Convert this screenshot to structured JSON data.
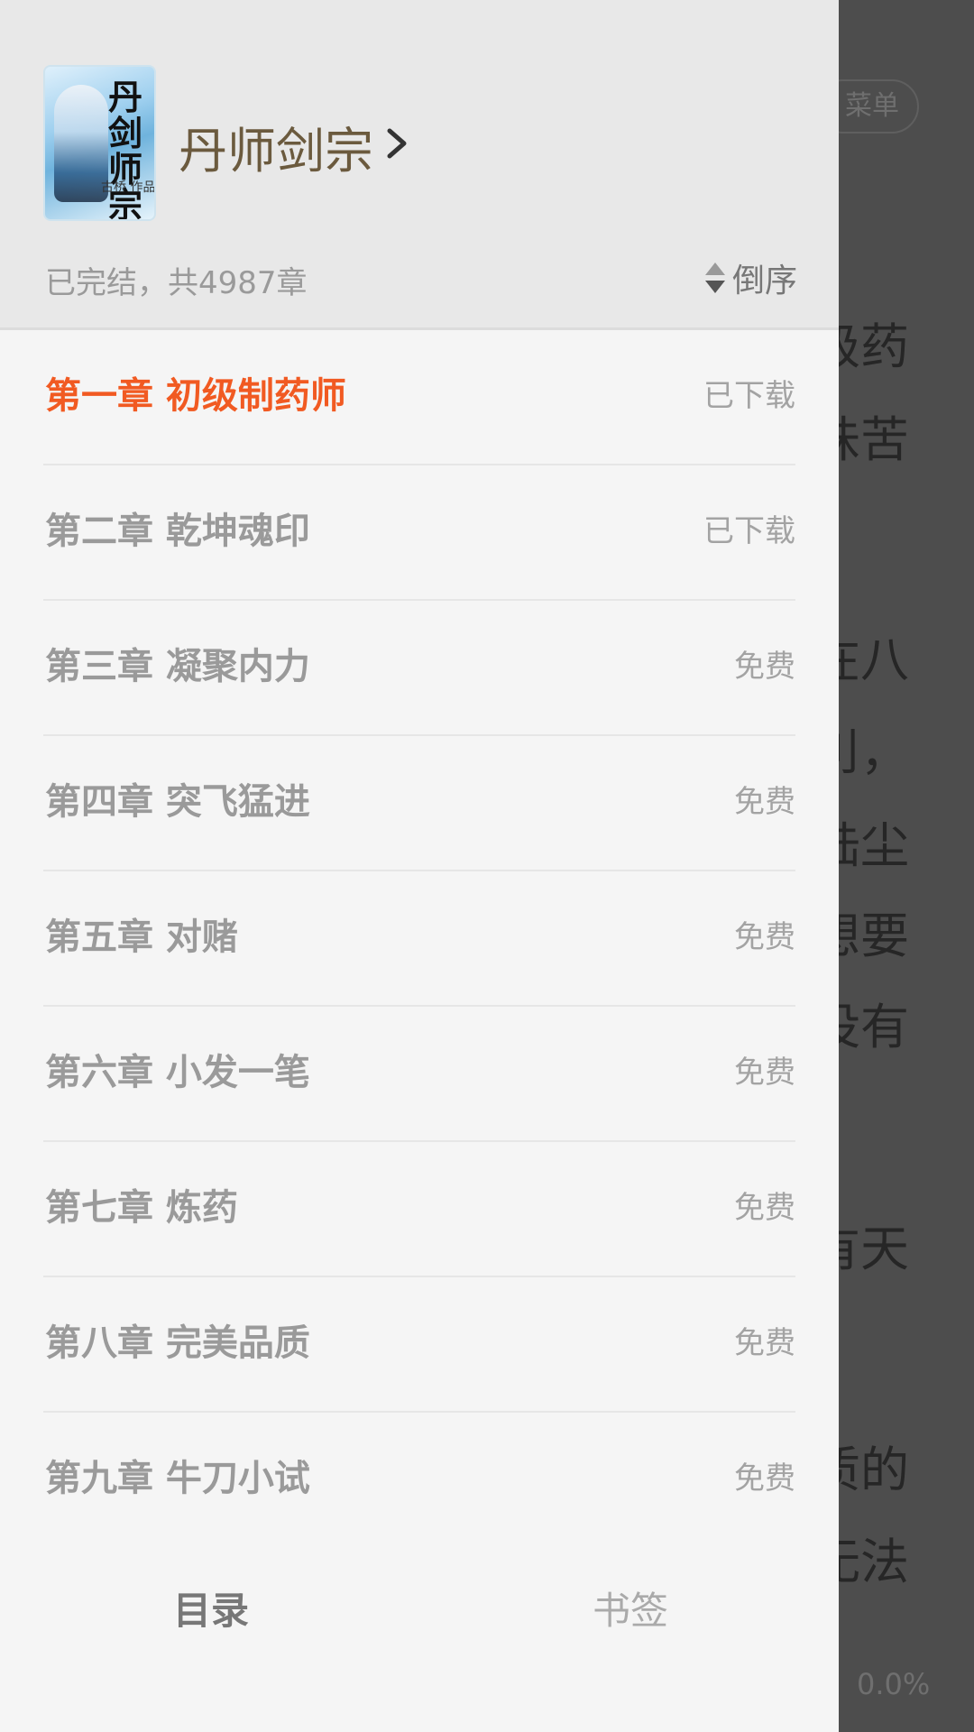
{
  "reader": {
    "menu_label": "菜单",
    "visible_text_fragments": [
      "级药",
      "味苦",
      "在八",
      "刂，",
      "陆尘",
      "想要",
      "没有",
      "有天",
      "质的",
      "无法"
    ],
    "progress": "0.0%"
  },
  "drawer": {
    "book": {
      "title": "丹师剑宗",
      "cover_title_art": "丹剑师宗",
      "cover_author": "古桥 作品",
      "status": "已完结，共4987章",
      "sort_label": "倒序"
    },
    "chapters": [
      {
        "title": "第一章 初级制药师",
        "status": "已下载",
        "active": true
      },
      {
        "title": "第二章 乾坤魂印",
        "status": "已下载",
        "active": false
      },
      {
        "title": "第三章 凝聚内力",
        "status": "免费",
        "active": false
      },
      {
        "title": "第四章 突飞猛进",
        "status": "免费",
        "active": false
      },
      {
        "title": "第五章 对赌",
        "status": "免费",
        "active": false
      },
      {
        "title": "第六章 小发一笔",
        "status": "免费",
        "active": false
      },
      {
        "title": "第七章 炼药",
        "status": "免费",
        "active": false
      },
      {
        "title": "第八章 完美品质",
        "status": "免费",
        "active": false
      },
      {
        "title": "第九章 牛刀小试",
        "status": "免费",
        "active": false
      }
    ],
    "tabs": {
      "catalog": "目录",
      "bookmark": "书签"
    }
  },
  "colors": {
    "accent": "#f15a22",
    "book_title": "#6b5a3e",
    "header_bg": "#e8e8e8",
    "drawer_bg": "#f5f5f5",
    "overlay": "#4d4d4d"
  }
}
